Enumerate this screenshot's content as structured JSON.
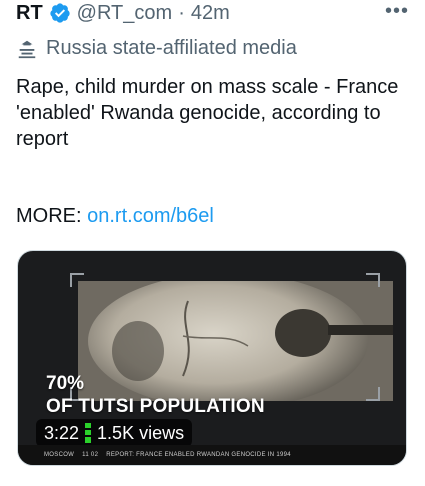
{
  "tweet": {
    "author_name": "RT",
    "handle": "@RT_com",
    "separator": "·",
    "time": "42m",
    "more_icon": "•••",
    "label": "Russia state-affiliated media",
    "text": "Rape, child murder on mass scale - France 'enabled' Rwanda genocide, according to report",
    "more_prefix": "MORE: ",
    "more_link": "on.rt.com/b6el"
  },
  "media": {
    "overlay_percent": "70%",
    "overlay_title": "OF TUTSI POPULATION",
    "duration": "3:22",
    "views": "1.5K views",
    "ticker_city": "MOSCOW",
    "ticker_time": "11 02",
    "ticker_text": "REPORT: FRANCE ENABLED RWANDAN GENOCIDE IN 1994"
  },
  "colors": {
    "link": "#1d9bf0",
    "verified": "#1d9bf0",
    "muted": "#536471"
  }
}
